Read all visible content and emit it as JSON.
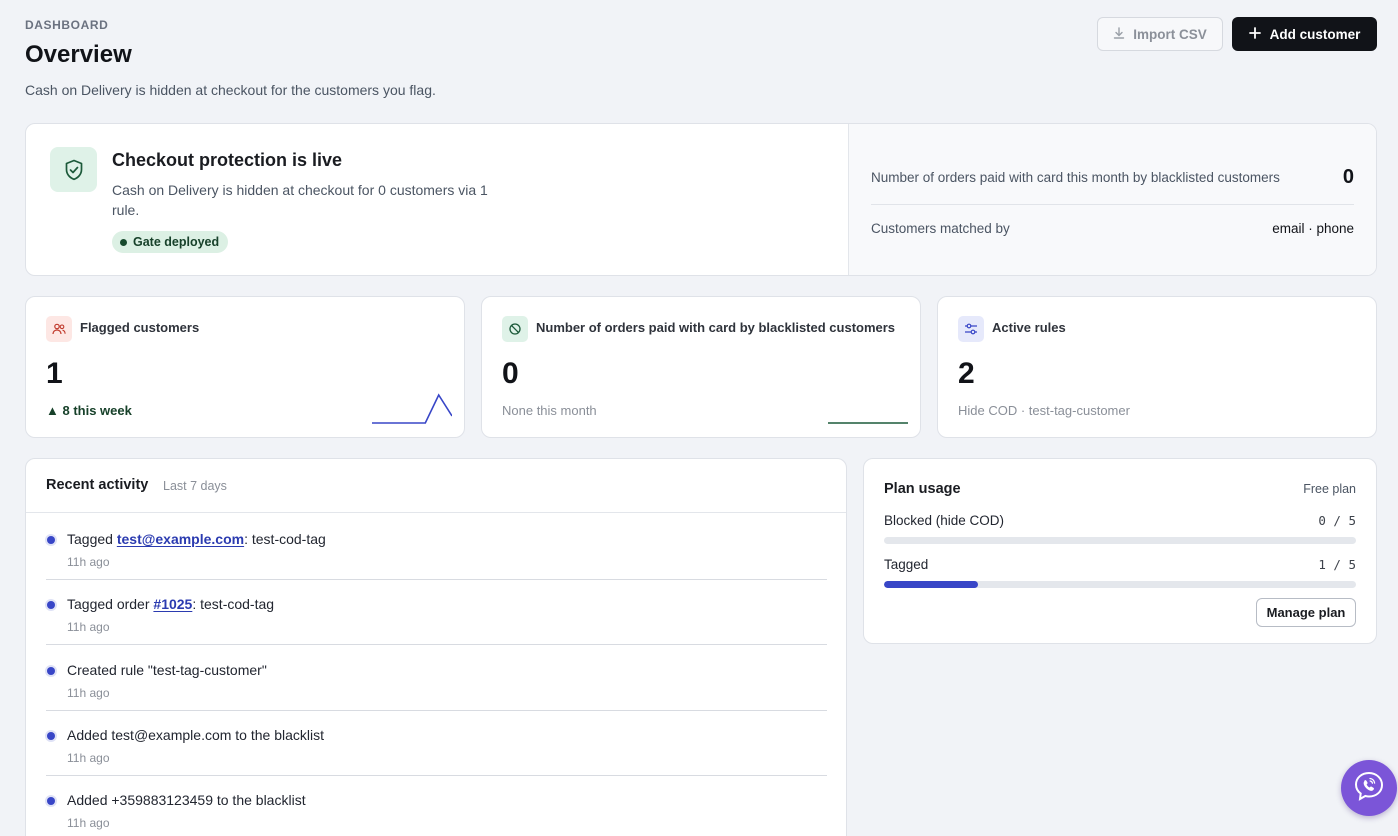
{
  "header": {
    "eyebrow": "DASHBOARD",
    "title": "Overview",
    "subtitle": "Cash on Delivery is hidden at checkout for the customers you flag.",
    "import_label": "Import CSV",
    "add_label": "Add customer"
  },
  "hero": {
    "title": "Checkout protection is live",
    "description": "Cash on Delivery is hidden at checkout for 0 customers via 1 rule.",
    "badge": "Gate deployed",
    "orders_label": "Number of orders paid with card this month by blacklisted customers",
    "orders_value": "0",
    "matched_label": "Customers matched by",
    "matched_value": "email · phone"
  },
  "stats": [
    {
      "label": "Flagged customers",
      "value": "1",
      "sub": "▲ 8 this week",
      "icon": "users-icon",
      "spark": [
        0,
        0,
        0,
        0,
        0,
        1,
        0.25
      ]
    },
    {
      "label": "Number of orders paid with card by blacklisted customers",
      "value": "0",
      "sub": "None this month",
      "icon": "ban-icon",
      "spark": [
        0,
        0,
        0,
        0,
        0,
        0,
        0
      ]
    },
    {
      "label": "Active rules",
      "value": "2",
      "sub": "Hide COD · test-tag-customer",
      "icon": "sliders-icon"
    }
  ],
  "activity": {
    "title": "Recent activity",
    "range": "Last 7 days",
    "items": [
      {
        "prefix": "Tagged ",
        "link": "test@example.com",
        "suffix": ": test-cod-tag",
        "time": "11h ago"
      },
      {
        "prefix": "Tagged order ",
        "link": "#1025",
        "suffix": ": test-cod-tag",
        "time": "11h ago"
      },
      {
        "prefix": "Created rule \"test-tag-customer\"",
        "link": "",
        "suffix": "",
        "time": "11h ago"
      },
      {
        "prefix": "Added test@example.com to the blacklist",
        "link": "",
        "suffix": "",
        "time": "11h ago"
      },
      {
        "prefix": "Added +359883123459 to the blacklist",
        "link": "",
        "suffix": "",
        "time": "11h ago"
      }
    ]
  },
  "plan": {
    "title": "Plan usage",
    "tier": "Free plan",
    "rows": [
      {
        "label": "Blocked (hide COD)",
        "count": "0 / 5",
        "used": 0,
        "limit": 5
      },
      {
        "label": "Tagged",
        "count": "1 / 5",
        "used": 1,
        "limit": 5
      }
    ],
    "manage_label": "Manage plan"
  },
  "colors": {
    "accent": "#3846c7",
    "success": "#174a2e",
    "chat": "#7b55d8"
  }
}
